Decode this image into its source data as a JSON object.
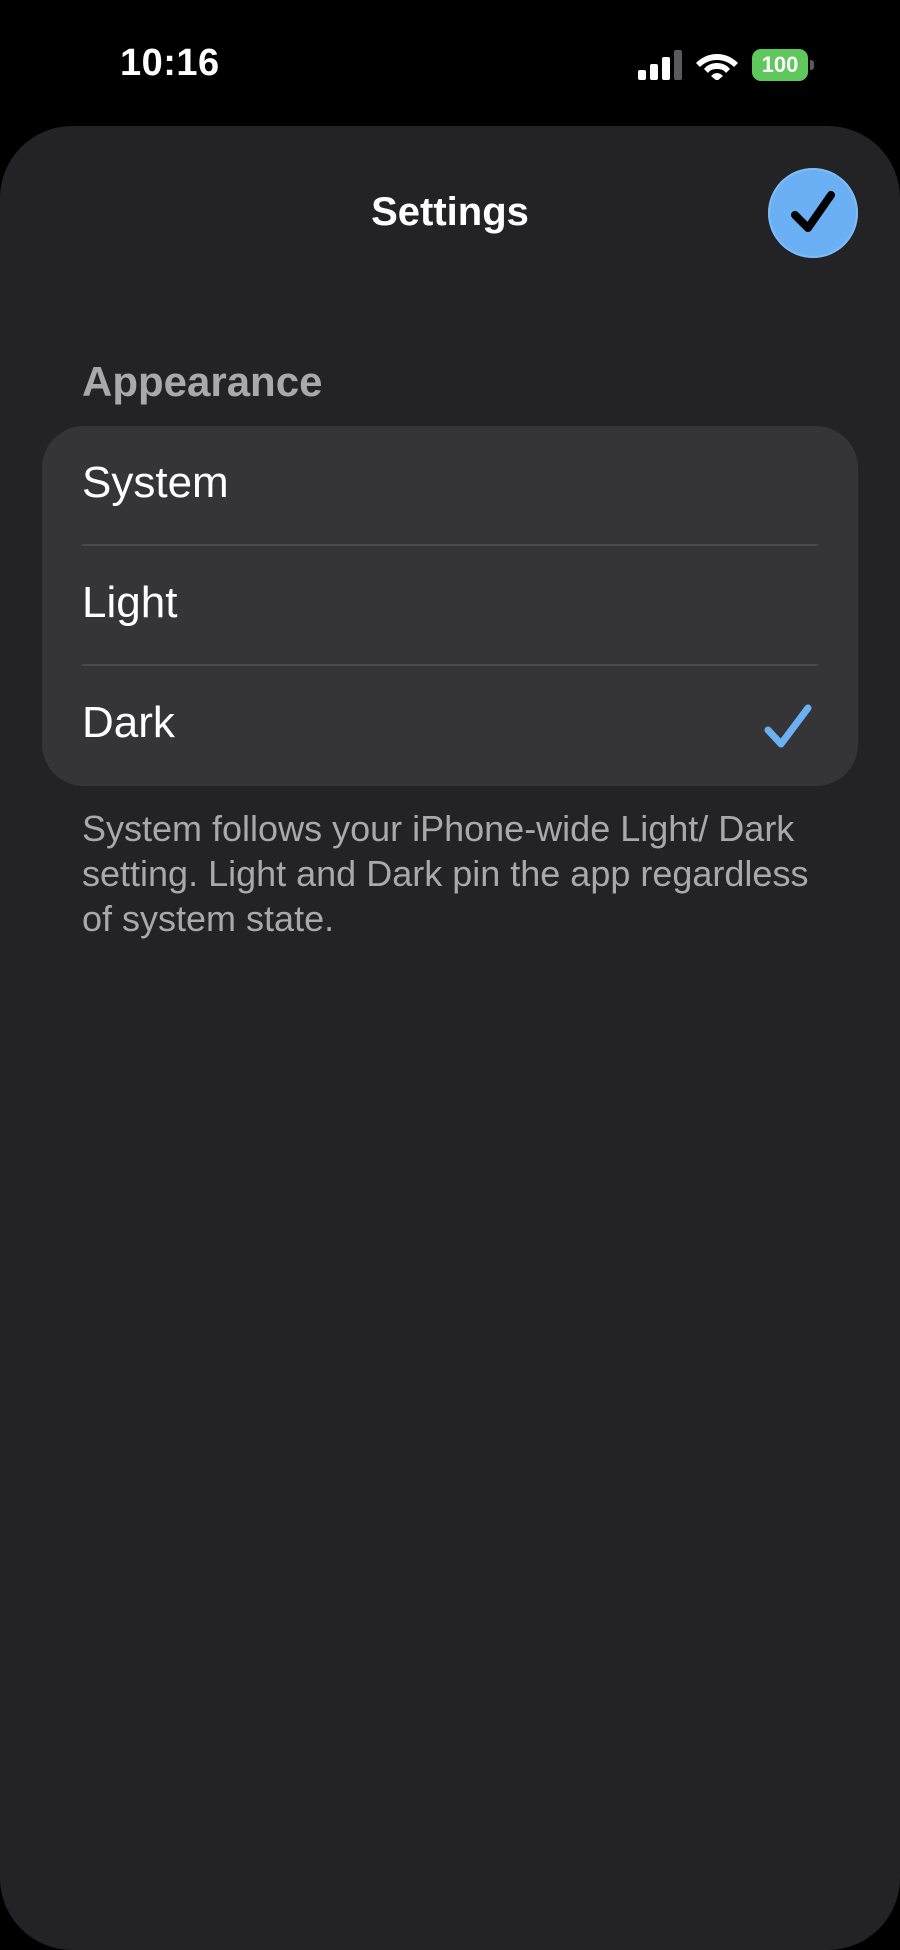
{
  "status_bar": {
    "time": "10:16",
    "battery_level": "100",
    "signal_icon": "cellular-signal-icon",
    "wifi_icon": "wifi-icon",
    "battery_color": "#5fc85c"
  },
  "sheet": {
    "title": "Settings",
    "done_icon": "checkmark-icon",
    "accent_color": "#6bb0f4"
  },
  "appearance": {
    "header": "Appearance",
    "options": [
      {
        "label": "System",
        "selected": false
      },
      {
        "label": "Light",
        "selected": false
      },
      {
        "label": "Dark",
        "selected": true
      }
    ],
    "footer": "System follows your iPhone-wide Light/ Dark setting. Light and Dark pin the app regardless of system state."
  }
}
